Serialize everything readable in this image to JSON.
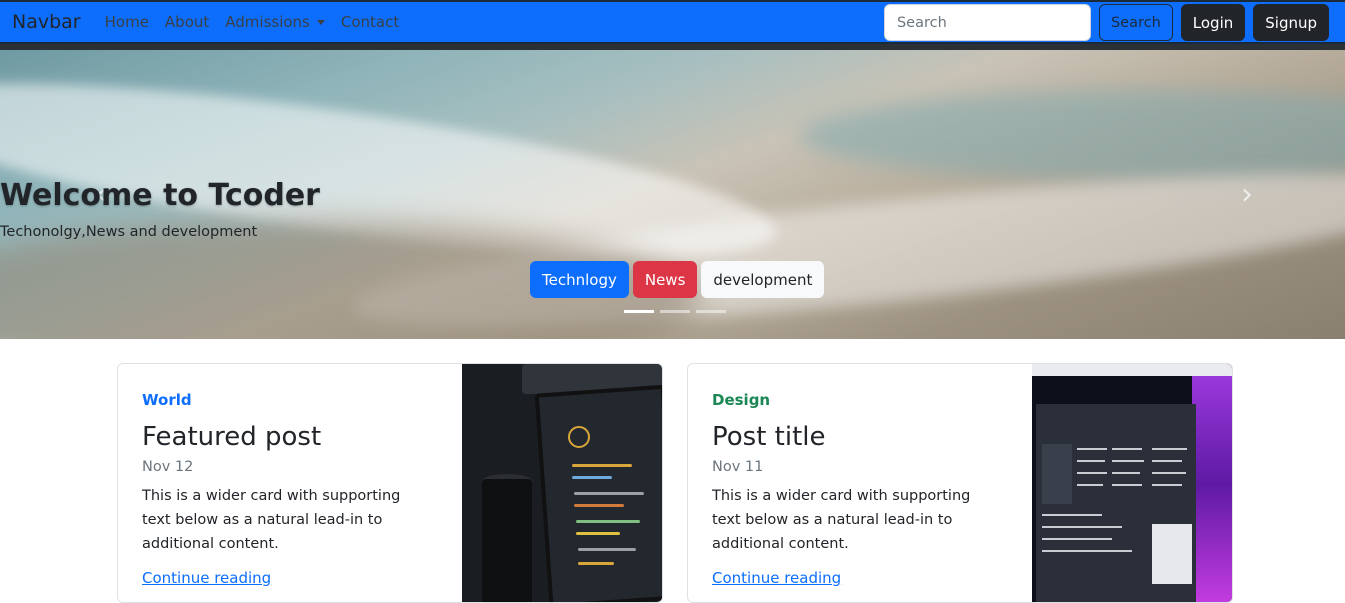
{
  "navbar": {
    "brand": "Navbar",
    "links": [
      {
        "label": "Home"
      },
      {
        "label": "About"
      },
      {
        "label": "Admissions",
        "dropdown": true
      },
      {
        "label": "Contact"
      }
    ],
    "search_placeholder": "Search",
    "search_button": "Search",
    "login_button": "Login",
    "signup_button": "Signup",
    "colors": {
      "primary": "#0d6efd",
      "dark": "#212529"
    }
  },
  "carousel": {
    "title": "Welcome to Tcoder",
    "subtitle": "Techonolgy,News and development",
    "buttons": [
      "Technlogy",
      "News",
      "development"
    ],
    "active_slide": 1,
    "slide_count": 3,
    "prev_icon": "chevron-left-icon",
    "next_icon": "chevron-right-icon"
  },
  "cards": [
    {
      "category": "World",
      "category_color": "#0d6efd",
      "title": "Featured post",
      "date": "Nov 12",
      "text": "This is a wider card with supporting text below as a natural lead-in to additional content.",
      "link": "Continue reading"
    },
    {
      "category": "Design",
      "category_color": "#198754",
      "title": "Post title",
      "date": "Nov 11",
      "text": "This is a wider card with supporting text below as a natural lead-in to additional content.",
      "link": "Continue reading"
    }
  ]
}
